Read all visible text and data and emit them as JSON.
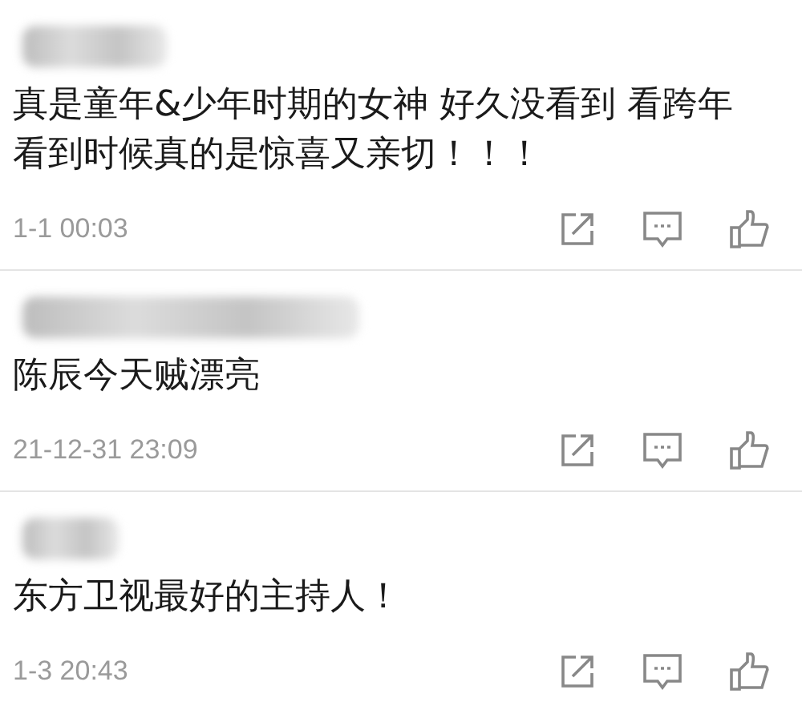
{
  "comments": [
    {
      "text": "真是童年&少年时期的女神 好久没看到 看跨年看到时候真的是惊喜又亲切！！！",
      "time": "1-1 00:03"
    },
    {
      "text": "陈辰今天贼漂亮",
      "time": "21-12-31 23:09"
    },
    {
      "text": "东方卫视最好的主持人！",
      "time": "1-3 20:43"
    }
  ]
}
